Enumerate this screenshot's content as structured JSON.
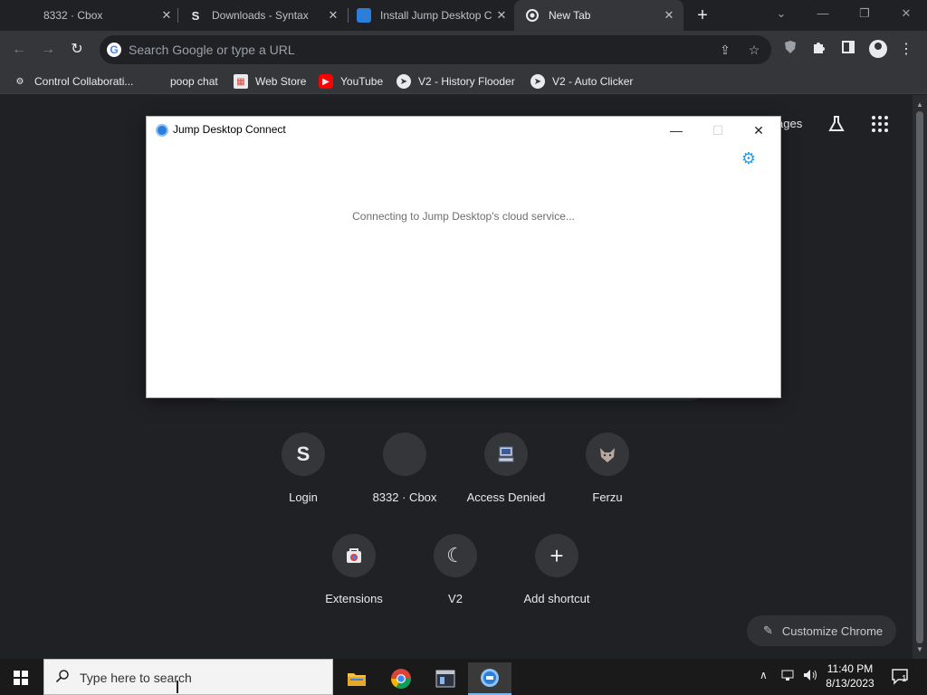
{
  "tabs": [
    {
      "title": "8332 · Cbox",
      "icon": "cbox-icon"
    },
    {
      "title": "Downloads - Syntax",
      "icon": "syntax-s-icon"
    },
    {
      "title": "Install Jump Desktop C",
      "icon": "cloud-icon"
    },
    {
      "title": "New Tab",
      "icon": "chrome-icon"
    }
  ],
  "omnibox": {
    "placeholder": "Search Google or type a URL"
  },
  "bookmarks": [
    {
      "label": "Control Collaborati...",
      "icon": "gear-icon"
    },
    {
      "label": "poop chat",
      "icon": ""
    },
    {
      "label": "Web Store",
      "icon": "web-store-icon"
    },
    {
      "label": "YouTube",
      "icon": "youtube-icon"
    },
    {
      "label": "V2 - History Flooder",
      "icon": "compass-icon"
    },
    {
      "label": "V2 - Auto Clicker",
      "icon": "compass-icon"
    }
  ],
  "ntp": {
    "images_link": "ages",
    "shortcuts": [
      {
        "label": "Login",
        "glyph": "S"
      },
      {
        "label": "8332 · Cbox",
        "glyph": ""
      },
      {
        "label": "Access Denied",
        "glyph": ""
      },
      {
        "label": "Ferzu",
        "glyph": ""
      },
      {
        "label": "Extensions",
        "glyph": ""
      },
      {
        "label": "V2",
        "glyph": "☾"
      },
      {
        "label": "Add shortcut",
        "glyph": "+"
      }
    ],
    "customize_label": "Customize Chrome"
  },
  "dialog": {
    "title": "Jump Desktop Connect",
    "message": "Connecting to Jump Desktop's cloud service..."
  },
  "taskbar": {
    "search_placeholder": "Type here to search",
    "time": "11:40 PM",
    "date": "8/13/2023",
    "notification_count": "1"
  },
  "colors": {
    "chrome_bg": "#202124",
    "toolbar_bg": "#35363a",
    "accent_blue": "#2e9be6",
    "taskbar_bg": "#1a1a1a"
  }
}
